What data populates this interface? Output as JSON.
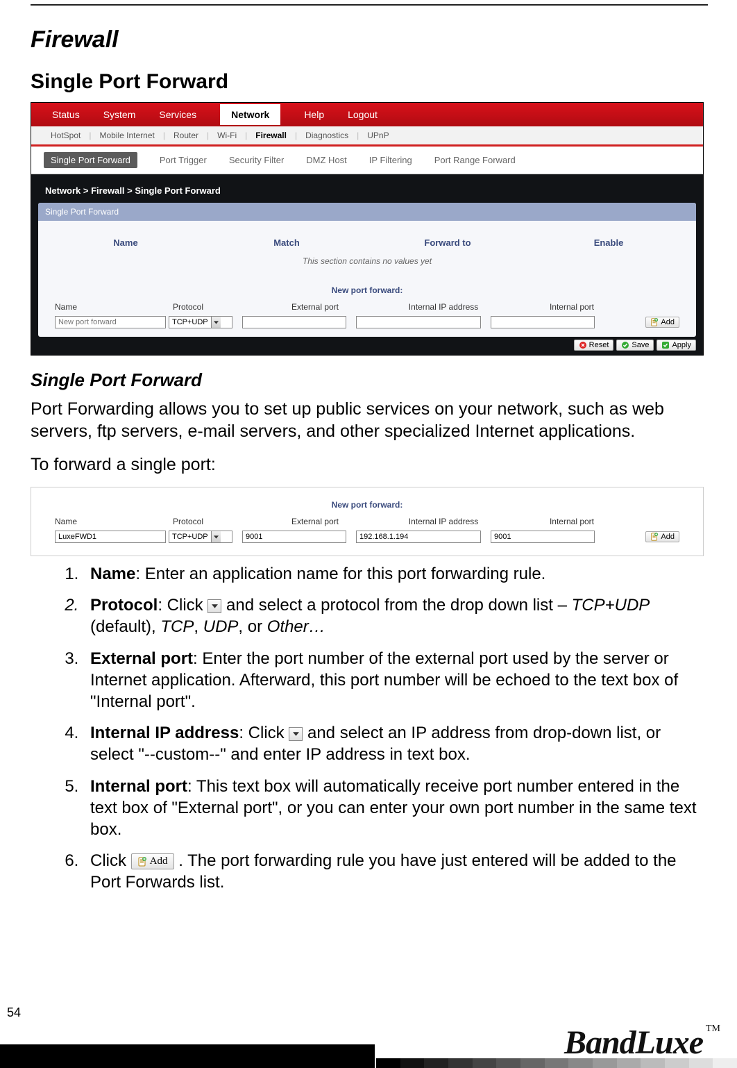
{
  "headings": {
    "firewall": "Firewall",
    "spf": "Single Port Forward",
    "spf2": "Single Port Forward"
  },
  "screenshot1": {
    "nav": [
      "Status",
      "System",
      "Services"
    ],
    "nav_active": "Network",
    "nav_after": [
      "Help",
      "Logout"
    ],
    "subnav": [
      "HotSpot",
      "Mobile Internet",
      "Router",
      "Wi-Fi"
    ],
    "subnav_active": "Firewall",
    "subnav_after": [
      "Diagnostics",
      "UPnP"
    ],
    "tabs_active": "Single Port Forward",
    "tabs": [
      "Port Trigger",
      "Security Filter",
      "DMZ Host",
      "IP Filtering",
      "Port Range Forward"
    ],
    "breadcrumb": "Network > Firewall > Single Port Forward",
    "panel_title": "Single Port Forward",
    "cols": [
      "Name",
      "Match",
      "Forward to",
      "Enable"
    ],
    "empty": "This section contains no values yet",
    "new_title": "New port forward:",
    "new_cols": {
      "name": "Name",
      "proto": "Protocol",
      "ext": "External port",
      "ip": "Internal IP address",
      "intp": "Internal port"
    },
    "new_row": {
      "name_placeholder": "New port forward",
      "proto_value": "TCP+UDP"
    },
    "add_btn": "Add",
    "actions": {
      "reset": "Reset",
      "save": "Save",
      "apply": "Apply"
    }
  },
  "description": {
    "p1": "Port Forwarding allows you to set up public services on your network, such as web servers, ftp servers, e-mail servers, and other specialized Internet applications.",
    "p2": "To forward a single port:"
  },
  "screenshot2": {
    "new_title": "New port forward:",
    "cols": {
      "name": "Name",
      "proto": "Protocol",
      "ext": "External port",
      "ip": "Internal IP address",
      "intp": "Internal port"
    },
    "row": {
      "name": "LuxeFWD1",
      "proto": "TCP+UDP",
      "ext": "9001",
      "ip": "192.168.1.194",
      "intp": "9001"
    },
    "add_btn": "Add"
  },
  "steps": {
    "s1": {
      "b": "Name",
      "t": ": Enter an application name for this port forwarding rule."
    },
    "s2": {
      "b": "Protocol",
      "t1": ": Click ",
      "t2": " and select a protocol from the drop down list – ",
      "i1": "TCP+UDP",
      "d": " (default), ",
      "i2": "TCP",
      "c1": ", ",
      "i3": "UDP",
      "c2": ", or ",
      "i4": "Other…"
    },
    "s3": {
      "b": "External port",
      "t": ": Enter the port number of the external port used by the server or Internet application. Afterward, this port number will be echoed to the text box of \"Internal port\"."
    },
    "s4": {
      "b": "Internal IP address",
      "t1": ": Click ",
      "t2": " and select an IP address from drop-down list, or select \"--custom--\" and enter IP address in text box."
    },
    "s5": {
      "b": "Internal port",
      "t": ": This text box will automatically receive port number entered in the text box of \"External port\", or you can enter your own port number in the same text box."
    },
    "s6": {
      "t1": "Click ",
      "btn": "Add",
      "t2": ". The port forwarding rule you have just entered will be added to the Port Forwards list."
    }
  },
  "page_number": "54",
  "logo": "BandLuxe",
  "tm": "TM"
}
